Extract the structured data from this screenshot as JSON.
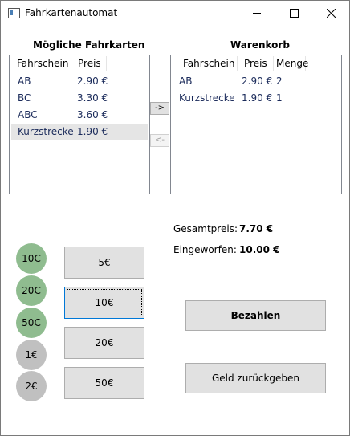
{
  "window": {
    "title": "Fahrkartenautomat",
    "minimize_icon": "minimize-icon",
    "maximize_icon": "maximize-icon",
    "close_icon": "close-icon"
  },
  "available": {
    "title": "Mögliche Fahrkarten",
    "columns": [
      "Fahrschein",
      "Preis"
    ],
    "rows": [
      {
        "name": "AB",
        "price": "2.90 €"
      },
      {
        "name": "BC",
        "price": "3.30 €"
      },
      {
        "name": "ABC",
        "price": "3.60 €"
      },
      {
        "name": "Kurzstrecke",
        "price": "1.90 €",
        "selected": true
      }
    ]
  },
  "transfer": {
    "add_label": "->",
    "remove_label": "<-"
  },
  "cart": {
    "title": "Warenkorb",
    "columns": [
      "Fahrschein",
      "Preis",
      "Menge"
    ],
    "rows": [
      {
        "name": "AB",
        "price": "2.90 €",
        "qty": "2"
      },
      {
        "name": "Kurzstrecke",
        "price": "1.90 €",
        "qty": "1"
      }
    ]
  },
  "totals": {
    "total_label": "Gesamtpreis:",
    "total_value": "7.70 €",
    "inserted_label": "Eingeworfen:",
    "inserted_value": "10.00 €"
  },
  "coins": [
    {
      "label": "10C",
      "color": "#8fbc8f"
    },
    {
      "label": "20C",
      "color": "#8fbc8f"
    },
    {
      "label": "50C",
      "color": "#8fbc8f"
    },
    {
      "label": "1€",
      "color": "#c0c0c0"
    },
    {
      "label": "2€",
      "color": "#c0c0c0"
    }
  ],
  "notes": [
    "5€",
    "10€",
    "20€",
    "50€"
  ],
  "actions": {
    "pay_label": "Bezahlen",
    "refund_label": "Geld zurückgeben"
  }
}
